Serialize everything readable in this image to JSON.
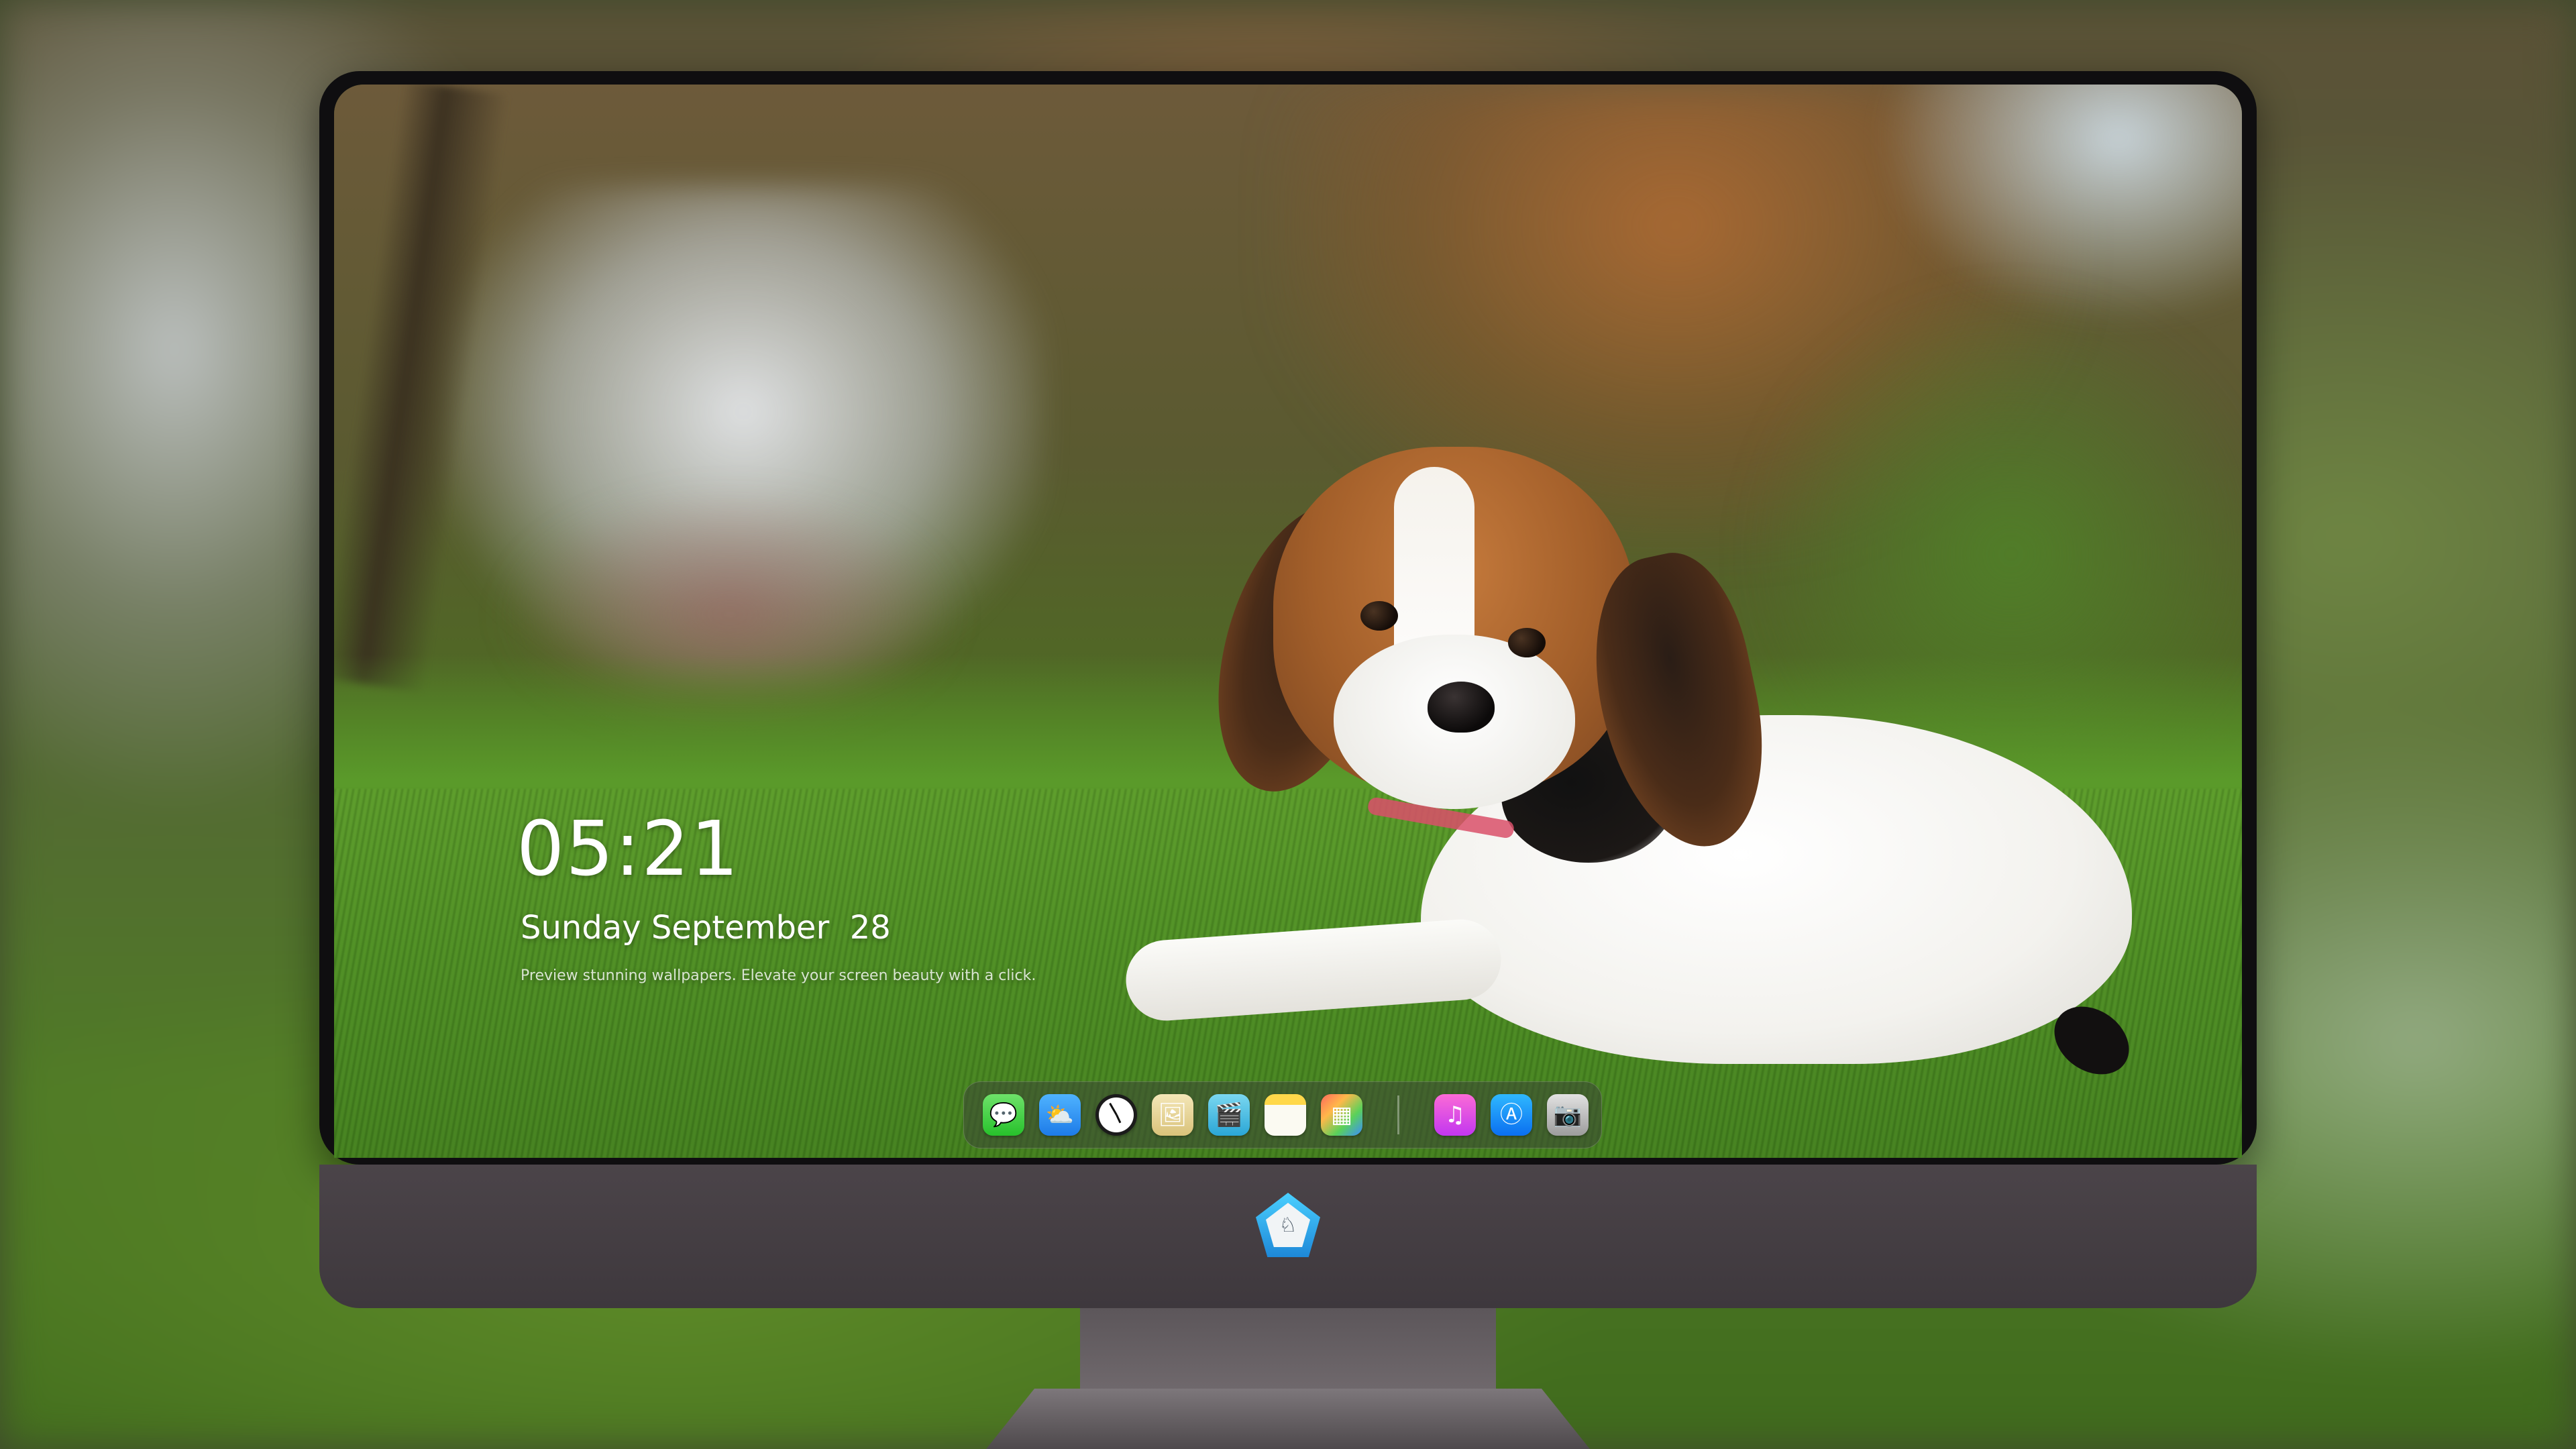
{
  "lock_screen": {
    "time": "05:21",
    "date": "Sunday September  28",
    "tagline": "Preview stunning wallpapers. Elevate your screen beauty with a click."
  },
  "wallpaper": {
    "subject": "beagle puppy lying on grass"
  },
  "dock": {
    "apps": [
      {
        "name": "Messages",
        "icon": "messages-icon",
        "glyph": "💬"
      },
      {
        "name": "Weather",
        "icon": "weather-icon",
        "glyph": "⛅"
      },
      {
        "name": "Clock",
        "icon": "clock-icon",
        "glyph": ""
      },
      {
        "name": "Preview",
        "icon": "preview-icon",
        "glyph": "🖼"
      },
      {
        "name": "Claquette",
        "icon": "claquette-icon",
        "glyph": "🎬"
      },
      {
        "name": "Notes",
        "icon": "notes-icon",
        "glyph": ""
      },
      {
        "name": "Photos",
        "icon": "photos-icon",
        "glyph": "▦"
      }
    ],
    "pinned": [
      {
        "name": "Music",
        "icon": "music-icon",
        "glyph": "♫"
      },
      {
        "name": "App Store",
        "icon": "app-store-icon",
        "glyph": "Ⓐ"
      },
      {
        "name": "Camera",
        "icon": "camera-icon",
        "glyph": "📷"
      }
    ]
  },
  "monitor": {
    "logo": "brand-logo-icon",
    "logo_glyph": "♘"
  },
  "colors": {
    "bezel": "#0f0e10",
    "chin": "#4b4449",
    "dock_background": "rgba(60,70,55,0.55)",
    "text": "#ffffff"
  }
}
